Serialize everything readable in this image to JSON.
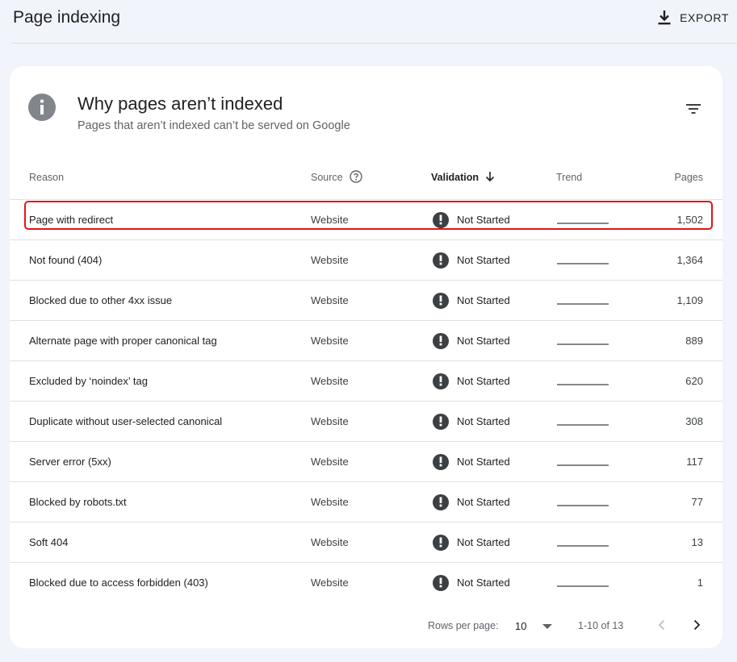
{
  "header": {
    "title": "Page indexing",
    "export_label": "EXPORT"
  },
  "card": {
    "title": "Why pages aren’t indexed",
    "subtitle": "Pages that aren’t indexed can’t be served on Google"
  },
  "table": {
    "columns": {
      "reason": "Reason",
      "source": "Source",
      "validation": "Validation",
      "trend": "Trend",
      "pages": "Pages"
    },
    "sort": {
      "column": "validation",
      "direction": "descending"
    },
    "highlighted_row": 0,
    "rows": [
      {
        "reason": "Page with redirect",
        "source": "Website",
        "validation": "Not Started",
        "pages": "1,502"
      },
      {
        "reason": "Not found (404)",
        "source": "Website",
        "validation": "Not Started",
        "pages": "1,364"
      },
      {
        "reason": "Blocked due to other 4xx issue",
        "source": "Website",
        "validation": "Not Started",
        "pages": "1,109"
      },
      {
        "reason": "Alternate page with proper canonical tag",
        "source": "Website",
        "validation": "Not Started",
        "pages": "889"
      },
      {
        "reason": "Excluded by ‘noindex’ tag",
        "source": "Website",
        "validation": "Not Started",
        "pages": "620"
      },
      {
        "reason": "Duplicate without user-selected canonical",
        "source": "Website",
        "validation": "Not Started",
        "pages": "308"
      },
      {
        "reason": "Server error (5xx)",
        "source": "Website",
        "validation": "Not Started",
        "pages": "117"
      },
      {
        "reason": "Blocked by robots.txt",
        "source": "Website",
        "validation": "Not Started",
        "pages": "77"
      },
      {
        "reason": "Soft 404",
        "source": "Website",
        "validation": "Not Started",
        "pages": "13"
      },
      {
        "reason": "Blocked due to access forbidden (403)",
        "source": "Website",
        "validation": "Not Started",
        "pages": "1"
      }
    ]
  },
  "pagination": {
    "rows_per_page_label": "Rows per page:",
    "rows_per_page_value": "10",
    "range_text": "1-10 of 13"
  },
  "colors": {
    "highlight_border": "#e0151c",
    "status_icon": "#3c4043",
    "info_icon": "#80868b"
  }
}
